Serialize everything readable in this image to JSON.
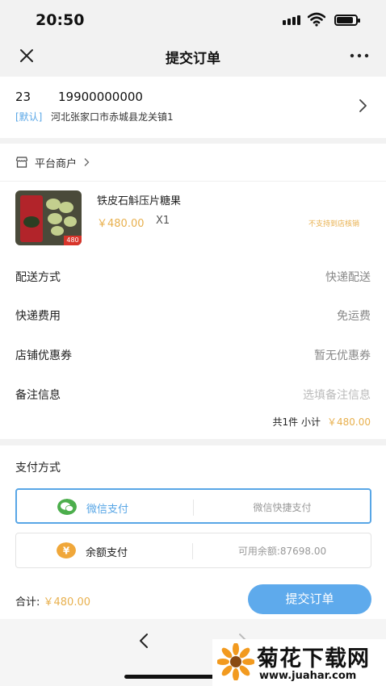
{
  "status_bar": {
    "time": "20:50"
  },
  "nav": {
    "title": "提交订单",
    "close_icon": "close-icon",
    "more_icon": "more-icon"
  },
  "address": {
    "name": "23",
    "phone": "19900000000",
    "tag": "[默认]",
    "text": "河北张家口市赤城县龙关镇1"
  },
  "order": {
    "merchant": "平台商户",
    "product": {
      "name": "铁皮石斛压片糖果",
      "price": "￥480.00",
      "qty": "X1",
      "note": "不支持到店核销",
      "sticker": "480"
    },
    "rows": [
      {
        "label": "配送方式",
        "value": "快递配送",
        "placeholder": false
      },
      {
        "label": "快递费用",
        "value": "免运费",
        "placeholder": false
      },
      {
        "label": "店铺优惠券",
        "value": "暂无优惠券",
        "placeholder": false
      },
      {
        "label": "备注信息",
        "value": "选填备注信息",
        "placeholder": true
      }
    ],
    "summary_text": "共1件 小计",
    "summary_amount": "￥480.00"
  },
  "payment": {
    "title": "支付方式",
    "options": [
      {
        "label": "微信支付",
        "sub": "微信快捷支付",
        "selected": true,
        "color": "#4cae4c",
        "icon": "wechat-icon"
      },
      {
        "label": "余额支付",
        "sub": "可用余额:87698.00",
        "selected": false,
        "color": "#f0a73a",
        "icon": "yen-icon"
      }
    ],
    "total_label": "合计: ",
    "total_amount": "￥480.00",
    "submit_label": "提交订单"
  },
  "watermark": {
    "title": "菊花下载网",
    "url": "www.juahar.com"
  },
  "colors": {
    "accent": "#58a6e6",
    "price": "#e8b04e",
    "button": "#5eaaec"
  }
}
